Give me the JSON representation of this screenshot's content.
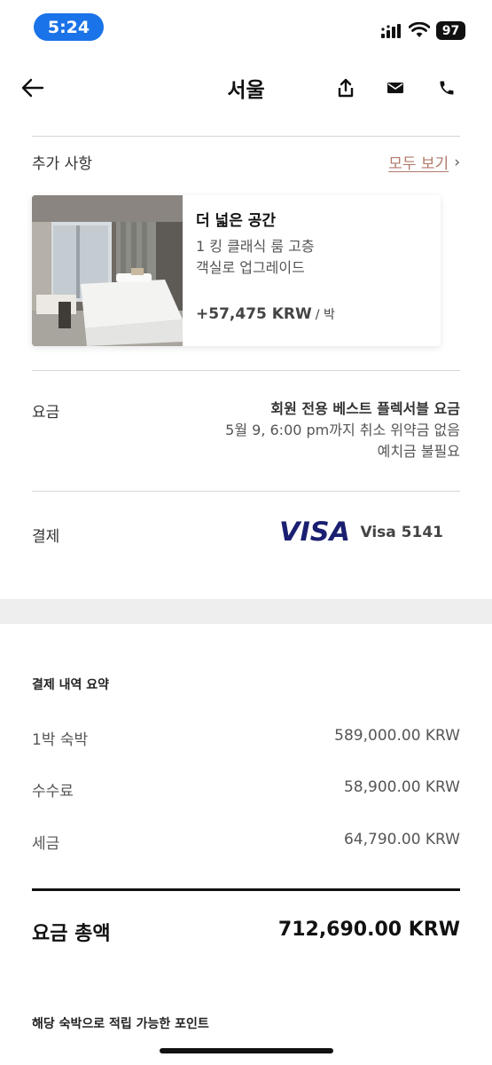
{
  "status_bar": {
    "time": "5:24",
    "battery": "97"
  },
  "header": {
    "title": "서울"
  },
  "extras": {
    "label": "추가 사항",
    "view_all": "모두 보기",
    "offer": {
      "title": "더 넓은 공간",
      "desc_line1": "1 킹 클래식 룸 고층",
      "desc_line2": "객실로 업그레이드",
      "price": "+57,475 KRW",
      "unit": "/ 박"
    }
  },
  "rate": {
    "label": "요금",
    "name": "회원 전용 베스트 플렉서블 요금",
    "cancel": "5월 9, 6:00 pm까지 취소 위약금 없음",
    "deposit": "예치금 불필요"
  },
  "payment": {
    "label": "결제",
    "brand": "VISA",
    "card": "Visa 5141"
  },
  "summary": {
    "title": "결제 내역 요약",
    "rows": [
      {
        "label": "1박 숙박",
        "value": "589,000.00 KRW"
      },
      {
        "label": "수수료",
        "value": "58,900.00 KRW"
      },
      {
        "label": "세금",
        "value": "64,790.00 KRW"
      }
    ],
    "total_label": "요금 총액",
    "total_value": "712,690.00 KRW"
  },
  "points": {
    "title": "해당 숙박으로 적립 가능한 포인트"
  },
  "colors": {
    "accent_link": "#b07a6a",
    "time_pill": "#1a73e8",
    "visa_blue": "#1a1f71"
  },
  "icons": [
    "back-arrow-icon",
    "share-icon",
    "mail-icon",
    "phone-icon",
    "signal-icon",
    "wifi-icon",
    "battery-icon"
  ]
}
